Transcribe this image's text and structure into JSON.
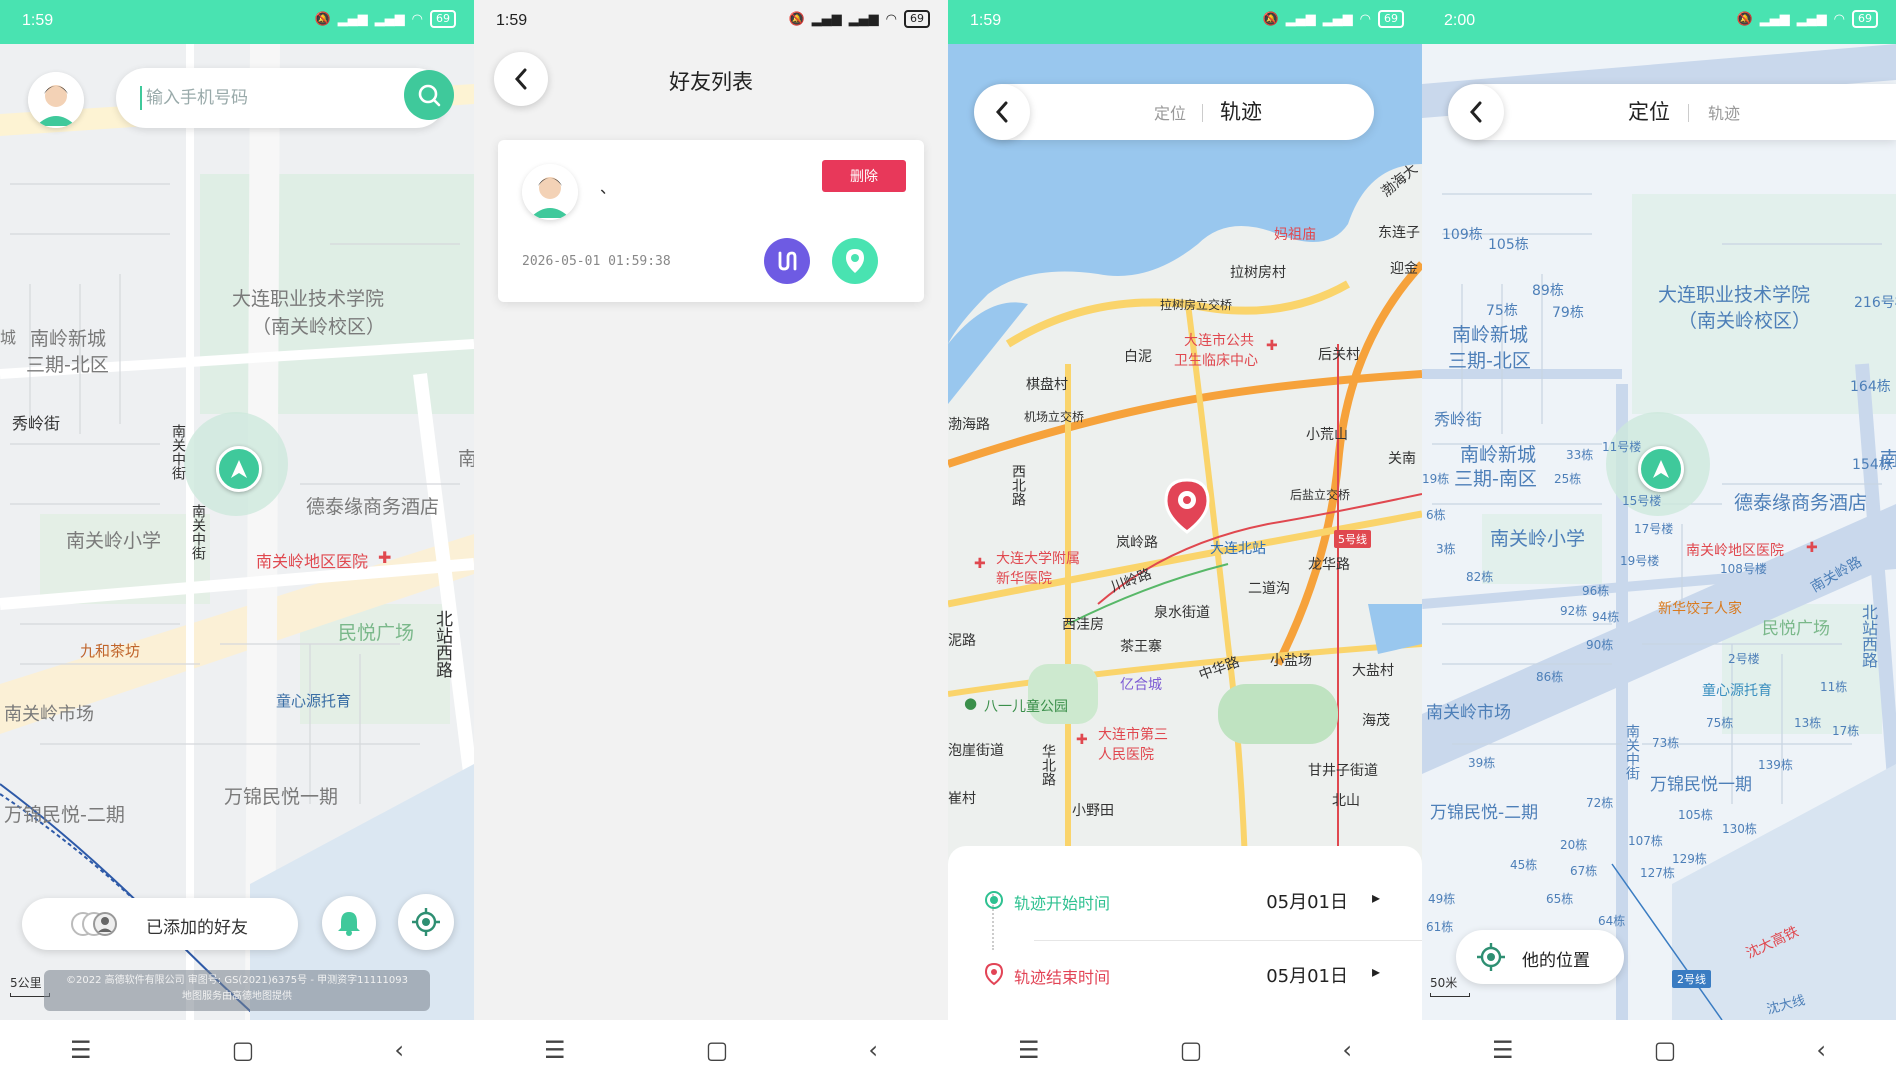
{
  "colors": {
    "accent": "#49e3b1",
    "green_button": "#3fc99b",
    "danger": "#e8385a",
    "purple": "#6e5be3",
    "pin_red": "#e24456"
  },
  "screens": [
    {
      "status": {
        "time": "1:59",
        "battery": "69"
      },
      "search": {
        "placeholder": "输入手机号码"
      },
      "friends_button": {
        "label": "已添加的好友"
      },
      "scale": "5公里",
      "copyright": {
        "line1": "©2022 高德软件有限公司   审图号: GS(2021)6375号 - 甲测资字11111093",
        "line2": "地图服务由高德地图提供"
      },
      "map_labels": [
        "大连职业技术学院",
        "（南关岭校区）",
        "南岭新城",
        "三期-北区",
        "秀岭街",
        "南关中街",
        "南关中街",
        "德泰缘商务酒店",
        "南关岭小学",
        "南关岭地区医院",
        "九和茶坊",
        "民悦广场",
        "北站西路",
        "童心源托育",
        "南关岭市场",
        "万锦民悦一期",
        "万锦民悦-二期",
        "南",
        "城"
      ]
    },
    {
      "status": {
        "time": "1:59",
        "battery": "69"
      },
      "title": "好友列表",
      "friend": {
        "name": "、",
        "timestamp": "2026-05-01 01:59:38",
        "delete_label": "删除"
      }
    },
    {
      "status": {
        "time": "1:59",
        "battery": "69"
      },
      "tabs": {
        "locate": "定位",
        "track": "轨迹"
      },
      "track_start": {
        "label": "轨迹开始时间",
        "value": "05月01日"
      },
      "track_end": {
        "label": "轨迹结束时间",
        "value": "05月01日"
      },
      "map_labels": [
        "渤海大",
        "妈祖庙",
        "东连子",
        "拉树房村",
        "迎金",
        "拉树房立交桥",
        "大连市公共",
        "卫生临床中心",
        "白泥",
        "后关村",
        "棋盘村",
        "机场立交桥",
        "渤海路",
        "小荒山",
        "关南",
        "西北路",
        "后盐立交桥",
        "5号线",
        "大连北站",
        "岚岭路",
        "大连大学附属",
        "新华医院",
        "川岭路",
        "龙华路",
        "二道沟",
        "泉水街道",
        "西洼房",
        "泥路",
        "茶王寨",
        "小盐场",
        "中华路",
        "大盐村",
        "亿合城",
        "八一儿童公园",
        "海茂",
        "大连市第三",
        "人民医院",
        "泡崖街道",
        "华北路",
        "甘井子街道",
        "崔村",
        "小野田",
        "北山"
      ]
    },
    {
      "status": {
        "time": "2:00",
        "battery": "69"
      },
      "tabs": {
        "locate": "定位",
        "track": "轨迹"
      },
      "his_location": {
        "label": "他的位置"
      },
      "scale": "50米",
      "map_labels": [
        "109栋",
        "105栋",
        "89栋",
        "75栋",
        "79栋",
        "大连职业技术学院",
        "（南关岭校区）",
        "216号楼",
        "南岭新城",
        "三期-北区",
        "164栋",
        "秀岭街",
        "154栋",
        "南岭新城",
        "33栋",
        "11号楼",
        "三期-南区",
        "25栋",
        "19栋",
        "15号楼",
        "德泰缘商务酒店",
        "6栋",
        "南关岭小学",
        "17号楼",
        "3栋",
        "南关岭地区医院",
        "南关岭路",
        "19号楼",
        "108号楼",
        "82栋",
        "96栋",
        "新华饺子人家",
        "92栋",
        "94栋",
        "民悦广场",
        "90栋",
        "北站西路",
        "2号楼",
        "86栋",
        "童心源托育",
        "11栋",
        "南关岭市场",
        "75栋",
        "13栋",
        "17栋",
        "73栋",
        "南关中街",
        "39栋",
        "139栋",
        "万锦民悦一期",
        "万锦民悦-二期",
        "72栋",
        "105栋",
        "130栋",
        "20栋",
        "107栋",
        "45栋",
        "67栋",
        "129栋",
        "127栋",
        "65栋",
        "49栋",
        "64栋",
        "61栋",
        "沈大高铁",
        "2号线",
        "沈大线",
        "南"
      ]
    }
  ]
}
